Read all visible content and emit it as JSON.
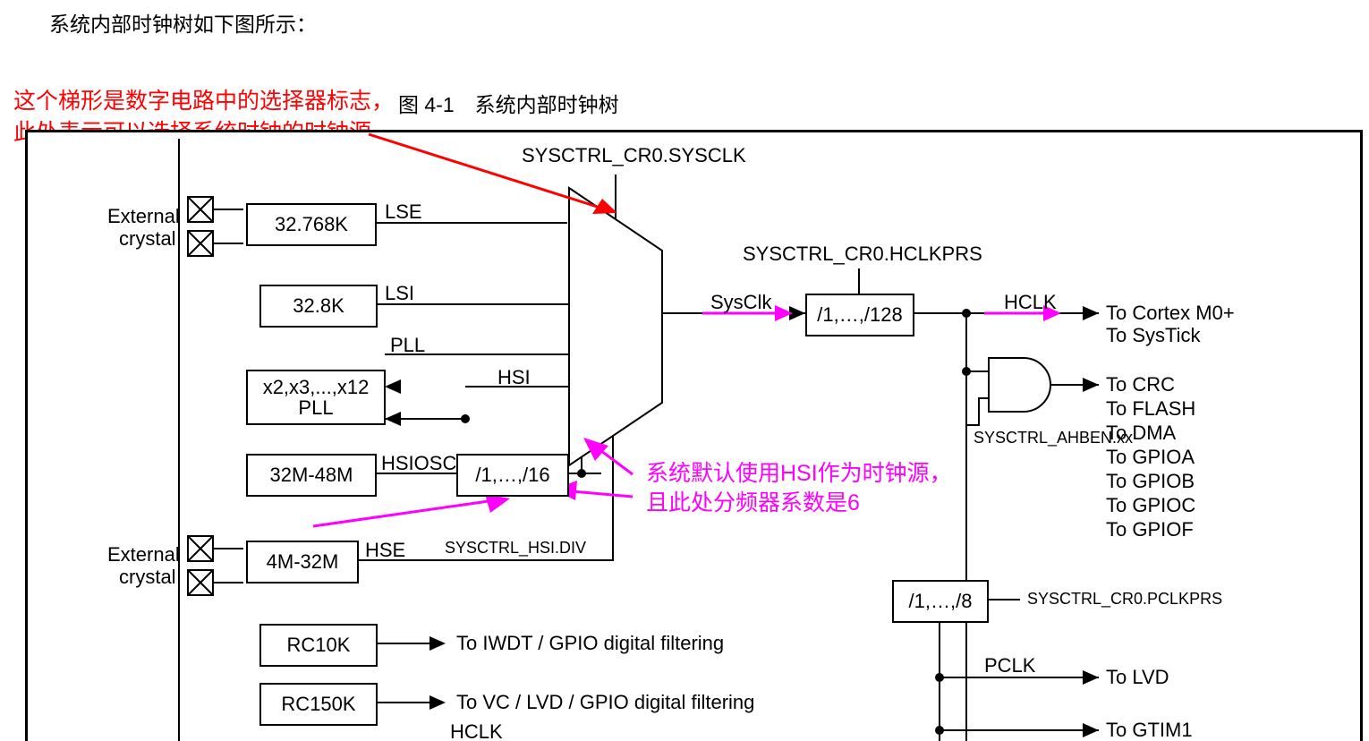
{
  "intro_text": "系统内部时钟树如下图所示：",
  "figure_caption": "图 4-1　系统内部时钟树",
  "annotations": {
    "red_line1": "这个梯形是数字电路中的选择器标志，",
    "red_line2": "此处表示可以选择系统时钟的时钟源",
    "mag_line1": "系统默认使用HSI作为时钟源，",
    "mag_line2": "且此处分频器系数是6"
  },
  "labels": {
    "sysctrl_cr0_sysclk": "SYSCTRL_CR0.SYSCLK",
    "sysctrl_cr0_hclkprs": "SYSCTRL_CR0.HCLKPRS",
    "sysctrl_ahben_xx": "SYSCTRL_AHBEN.xx",
    "sysctrl_cr0_pclkprs": "SYSCTRL_CR0.PCLKPRS",
    "sysctrl_hsi_div": "SYSCTRL_HSI.DIV",
    "external_crystal_top_1": "External",
    "external_crystal_top_2": "crystal",
    "external_crystal_bot_1": "External",
    "external_crystal_bot_2": "crystal",
    "lse": "LSE",
    "lsi": "LSI",
    "pll": "PLL",
    "hsi": "HSI",
    "hsiosc": "HSIOSC",
    "hse": "HSE",
    "sysclk": "SysClk",
    "hclk": "HCLK",
    "pclk": "PCLK"
  },
  "blocks": {
    "lse_osc": "32.768K",
    "lsi_osc": "32.8K",
    "pll_block_1": "x2,x3,...,x12",
    "pll_block_2": "PLL",
    "hsi_osc": "32M-48M",
    "hsi_div": "/1,…,/16",
    "hse_osc": "4M-32M",
    "rc10k": "RC10K",
    "rc150k": "RC150K",
    "hclk_div": "/1,…,/128",
    "pclk_div": "/1,…,/8"
  },
  "outputs": {
    "cortex": "To Cortex M0+",
    "systick": "To SysTick",
    "crc": "To CRC",
    "flash": "To FLASH",
    "dma": "To DMA",
    "gpioa": "To GPIOA",
    "gpiob": "To GPIOB",
    "gpioc": "To GPIOC",
    "gpiof": "To GPIOF",
    "iwdt": "To IWDT / GPIO digital filtering",
    "vc": "To VC / LVD / GPIO digital filtering",
    "hclk": "HCLK",
    "lvd": "To LVD",
    "gtim1": "To GTIM1"
  }
}
